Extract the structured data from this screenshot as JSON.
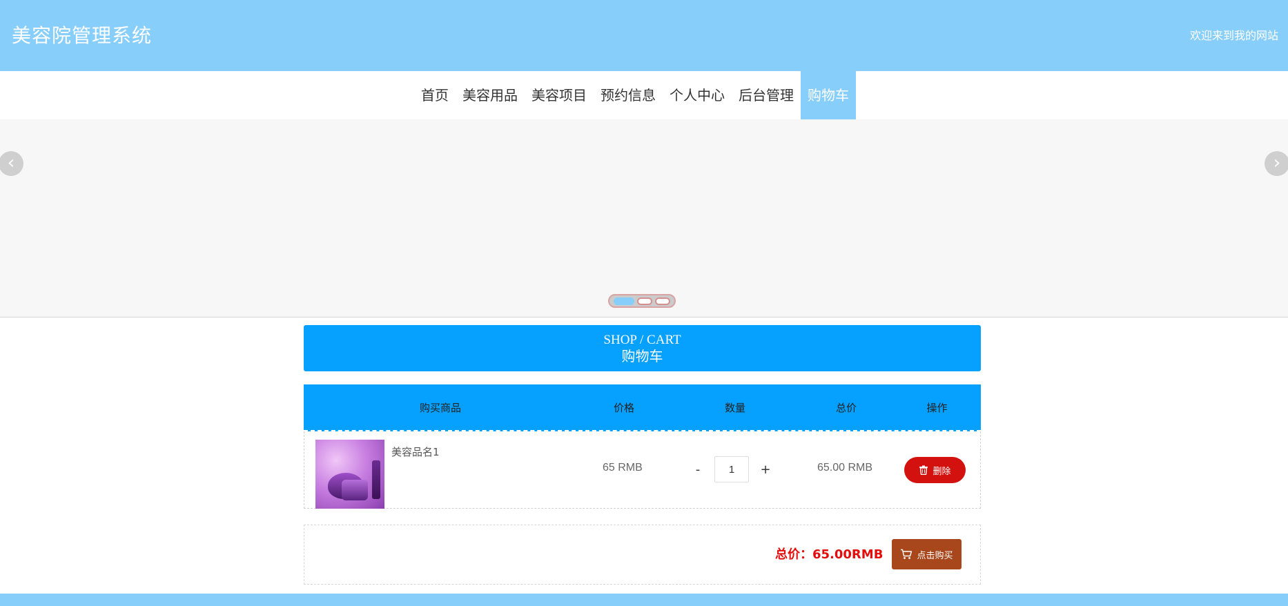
{
  "header": {
    "title": "美容院管理系统",
    "welcome": "欢迎来到我的网站"
  },
  "nav": {
    "items": [
      {
        "label": "首页"
      },
      {
        "label": "美容用品"
      },
      {
        "label": "美容项目"
      },
      {
        "label": "预约信息"
      },
      {
        "label": "个人中心"
      },
      {
        "label": "后台管理"
      },
      {
        "label": "购物车"
      }
    ],
    "active": "购物车"
  },
  "carousel": {
    "prev_icon": "chevron-left-icon",
    "next_icon": "chevron-right-icon",
    "slide_count": 3,
    "active_index": 0
  },
  "cart": {
    "heading_en": "SHOP / CART",
    "heading_cn": "购物车",
    "columns": [
      "购买商品",
      "价格",
      "数量",
      "总价",
      "操作"
    ],
    "items": [
      {
        "name": "美容品名1",
        "price": "65 RMB",
        "quantity": "1",
        "decrement": "-",
        "increment": "+",
        "total": "65.00 RMB",
        "delete_label": "删除"
      }
    ],
    "summary": "总价：65.00RMB",
    "buy_label": "点击购买"
  },
  "colors": {
    "header_bg": "#87cefa",
    "accent_blue": "#06a0ff",
    "delete_red": "#d3110f",
    "buy_brown": "#a8461c",
    "total_red": "#e30d0d"
  }
}
